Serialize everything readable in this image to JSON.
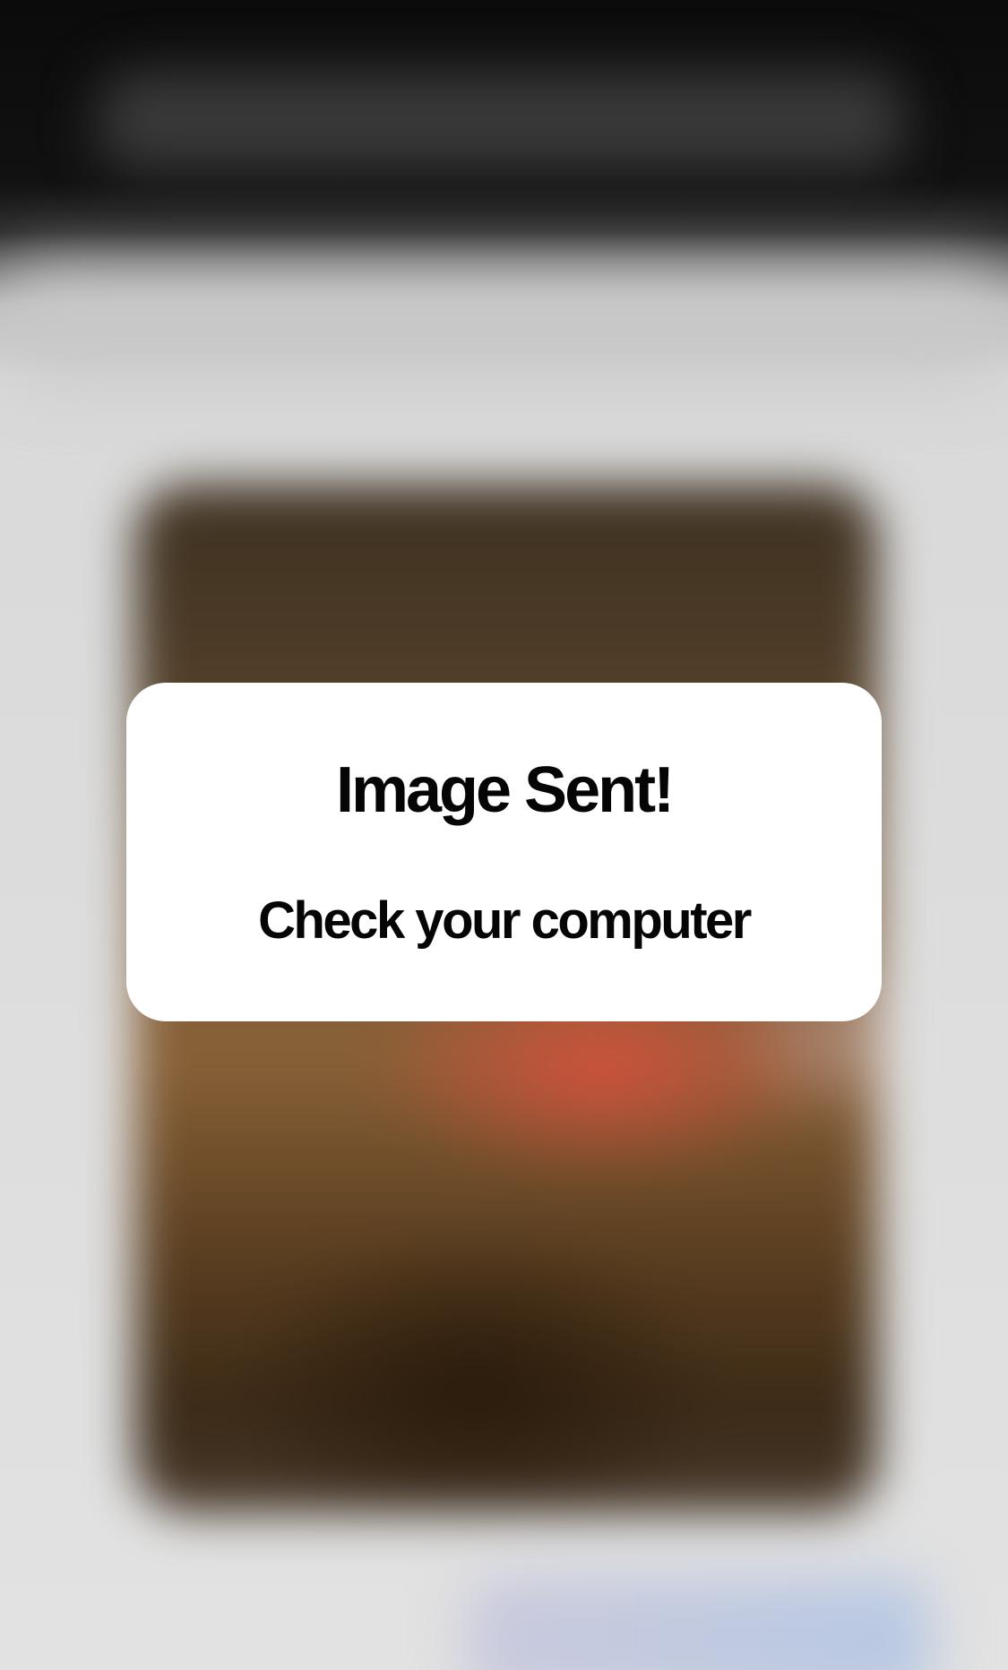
{
  "alert": {
    "title": "Image Sent!",
    "message": "Check your computer"
  },
  "colors": {
    "alert_background": "#ffffff",
    "alert_text": "#050505",
    "backdrop_top": "#0b0b0b",
    "backdrop_light": "#e2e2e2"
  }
}
